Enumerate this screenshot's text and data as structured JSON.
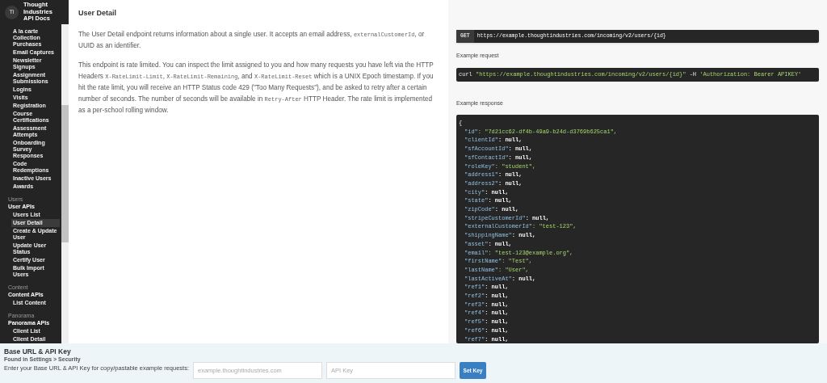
{
  "sidebar": {
    "logo": "Ti",
    "title": "Thought Industries API Docs",
    "sections": [
      {
        "items": [
          {
            "label": "A la carte Collection Purchases",
            "selected": false
          },
          {
            "label": "Email Captures",
            "selected": false
          },
          {
            "label": "Newsletter Signups",
            "selected": false
          },
          {
            "label": "Assignment Submissions",
            "selected": false
          },
          {
            "label": "Logins",
            "selected": false
          },
          {
            "label": "Visits",
            "selected": false
          },
          {
            "label": "Registration",
            "selected": false
          },
          {
            "label": "Course Certifications",
            "selected": false
          },
          {
            "label": "Assessment Attempts",
            "selected": false
          },
          {
            "label": "Onboarding Survey Responses",
            "selected": false
          },
          {
            "label": "Code Redemptions",
            "selected": false
          },
          {
            "label": "Inactive Users",
            "selected": false
          },
          {
            "label": "Awards",
            "selected": false
          }
        ]
      },
      {
        "heading": "Users",
        "group": "User APIs",
        "items": [
          {
            "label": "Users List",
            "selected": false
          },
          {
            "label": "User Detail",
            "selected": true
          },
          {
            "label": "Create & Update User",
            "selected": false
          },
          {
            "label": "Update User Status",
            "selected": false
          },
          {
            "label": "Certify User",
            "selected": false
          },
          {
            "label": "Bulk Import Users",
            "selected": false
          }
        ]
      },
      {
        "heading": "Content",
        "group": "Content APIs",
        "items": [
          {
            "label": "List Content",
            "selected": false
          }
        ]
      },
      {
        "heading": "Panorama",
        "group": "Panorama APIs",
        "items": [
          {
            "label": "Client List",
            "selected": false
          },
          {
            "label": "Client Detail",
            "selected": false
          }
        ]
      }
    ]
  },
  "main": {
    "title": "User Detail",
    "paragraphs": [
      [
        {
          "kind": "text",
          "text": "The User Detail endpoint returns information about a single user. It accepts an email address, "
        },
        {
          "kind": "code",
          "text": "externalCustomerId"
        },
        {
          "kind": "text",
          "text": ", or UUID as an identifier."
        }
      ],
      [
        {
          "kind": "text",
          "text": "This endpoint is rate limited. You can inspect the limit assigned to you and how many requests you have left via the HTTP Headers "
        },
        {
          "kind": "code",
          "text": "X-RateLimit-Limit"
        },
        {
          "kind": "text",
          "text": ", "
        },
        {
          "kind": "code",
          "text": "X-RateLimit-Remaining"
        },
        {
          "kind": "text",
          "text": ", and "
        },
        {
          "kind": "code",
          "text": "X-RateLimit-Reset"
        },
        {
          "kind": "text",
          "text": " which is a UNIX Epoch timestamp. If you hit the rate limit, you will receive an HTTP Status code 429 (\"Too Many Requests\"), and be asked to retry after a certain number of seconds. The number of seconds will be available in "
        },
        {
          "kind": "code",
          "text": "Retry-After"
        },
        {
          "kind": "text",
          "text": " HTTP Header. The rate limit is implemented as a per-school rolling window."
        }
      ]
    ]
  },
  "panel": {
    "method": "GET",
    "endpoint": "https://example.thoughtindustries.com/incoming/v2/users/{id}",
    "request_label": "Example request",
    "request": [
      {
        "kind": "plain",
        "text": "curl "
      },
      {
        "kind": "string",
        "text": "\"https://example.thoughtindustries.com/incoming/v2/users/{id}\""
      },
      {
        "kind": "plain",
        "text": " -H "
      },
      {
        "kind": "string",
        "text": "'Authorization: Bearer APIKEY'"
      }
    ],
    "response_label": "Example response",
    "response_open": "{",
    "response": [
      {
        "line": "\"id\": \"7d21cc62-df4b-49a9-b24d-d3769b625ca1\",",
        "kind": "string"
      },
      {
        "line": "\"clientId\": null,",
        "kind": "null"
      },
      {
        "line": "\"sfAccountId\": null,",
        "kind": "null"
      },
      {
        "line": "\"sfContactId\": null,",
        "kind": "null"
      },
      {
        "line": "\"roleKey\": \"student\",",
        "kind": "string"
      },
      {
        "line": "\"address1\": null,",
        "kind": "null"
      },
      {
        "line": "\"address2\": null,",
        "kind": "null"
      },
      {
        "line": "\"city\": null,",
        "kind": "null"
      },
      {
        "line": "\"state\": null,",
        "kind": "null"
      },
      {
        "line": "\"zipCode\": null,",
        "kind": "null"
      },
      {
        "line": "\"stripeCustomerId\": null,",
        "kind": "null"
      },
      {
        "line": "\"externalCustomerId\": \"test-123\",",
        "kind": "string"
      },
      {
        "line": "\"shippingName\": null,",
        "kind": "null"
      },
      {
        "line": "\"asset\": null,",
        "kind": "null"
      },
      {
        "line": "\"email\": \"test-123@example.org\",",
        "kind": "string"
      },
      {
        "line": "\"firstName\": \"Test\",",
        "kind": "string"
      },
      {
        "line": "\"lastName\": \"User\",",
        "kind": "string"
      },
      {
        "line": "\"lastActiveAt\": null,",
        "kind": "null"
      },
      {
        "line": "\"ref1\": null,",
        "kind": "null"
      },
      {
        "line": "\"ref2\": null,",
        "kind": "null"
      },
      {
        "line": "\"ref3\": null,",
        "kind": "null"
      },
      {
        "line": "\"ref4\": null,",
        "kind": "null"
      },
      {
        "line": "\"ref5\": null,",
        "kind": "null"
      },
      {
        "line": "\"ref6\": null,",
        "kind": "null"
      },
      {
        "line": "\"ref7\": null,",
        "kind": "null"
      }
    ]
  },
  "footer": {
    "title": "Base URL & API Key",
    "subtitle": "Found in Settings > Security",
    "prompt": "Enter your Base URL & API Key for copy/pastable example requests:",
    "url_placeholder": "example.thoughtindustries.com",
    "key_placeholder": "API Key",
    "button": "Set Key"
  }
}
